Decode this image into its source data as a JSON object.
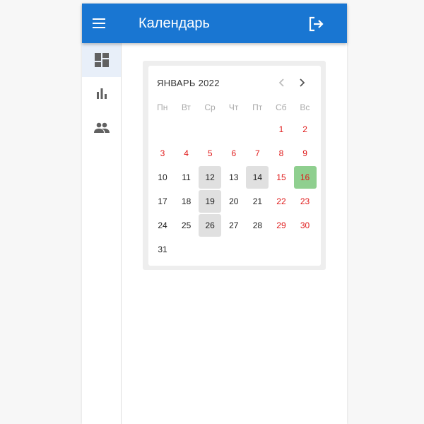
{
  "appbar": {
    "title": "Календарь",
    "color": "#1976d2"
  },
  "sidebar": {
    "items": [
      {
        "icon": "dashboard-icon",
        "active": true
      },
      {
        "icon": "bar-chart-icon",
        "active": false
      },
      {
        "icon": "people-icon",
        "active": false
      }
    ]
  },
  "calendar": {
    "month_label": "ЯНВАРЬ 2022",
    "weekdays": [
      "Пн",
      "Вт",
      "Ср",
      "Чт",
      "Пт",
      "Сб",
      "Вс"
    ],
    "leading_blanks": 5,
    "days": [
      {
        "d": "1",
        "weekend": true
      },
      {
        "d": "2",
        "weekend": true
      },
      {
        "d": "3",
        "weekend": true
      },
      {
        "d": "4",
        "weekend": true
      },
      {
        "d": "5",
        "weekend": true
      },
      {
        "d": "6",
        "weekend": true
      },
      {
        "d": "7",
        "weekend": true
      },
      {
        "d": "8",
        "weekend": true
      },
      {
        "d": "9",
        "weekend": true
      },
      {
        "d": "10"
      },
      {
        "d": "11"
      },
      {
        "d": "12",
        "marked": true
      },
      {
        "d": "13"
      },
      {
        "d": "14",
        "marked": true
      },
      {
        "d": "15",
        "weekend": true
      },
      {
        "d": "16",
        "weekend": true,
        "today": true
      },
      {
        "d": "17"
      },
      {
        "d": "18"
      },
      {
        "d": "19",
        "marked": true
      },
      {
        "d": "20"
      },
      {
        "d": "21"
      },
      {
        "d": "22",
        "weekend": true
      },
      {
        "d": "23",
        "weekend": true
      },
      {
        "d": "24"
      },
      {
        "d": "25"
      },
      {
        "d": "26",
        "marked": true
      },
      {
        "d": "27"
      },
      {
        "d": "28"
      },
      {
        "d": "29",
        "weekend": true
      },
      {
        "d": "30",
        "weekend": true
      },
      {
        "d": "31"
      }
    ],
    "colors": {
      "weekend": "#e01b1b",
      "marked": "#e0e0e0",
      "today": "#8fcf8f"
    }
  }
}
